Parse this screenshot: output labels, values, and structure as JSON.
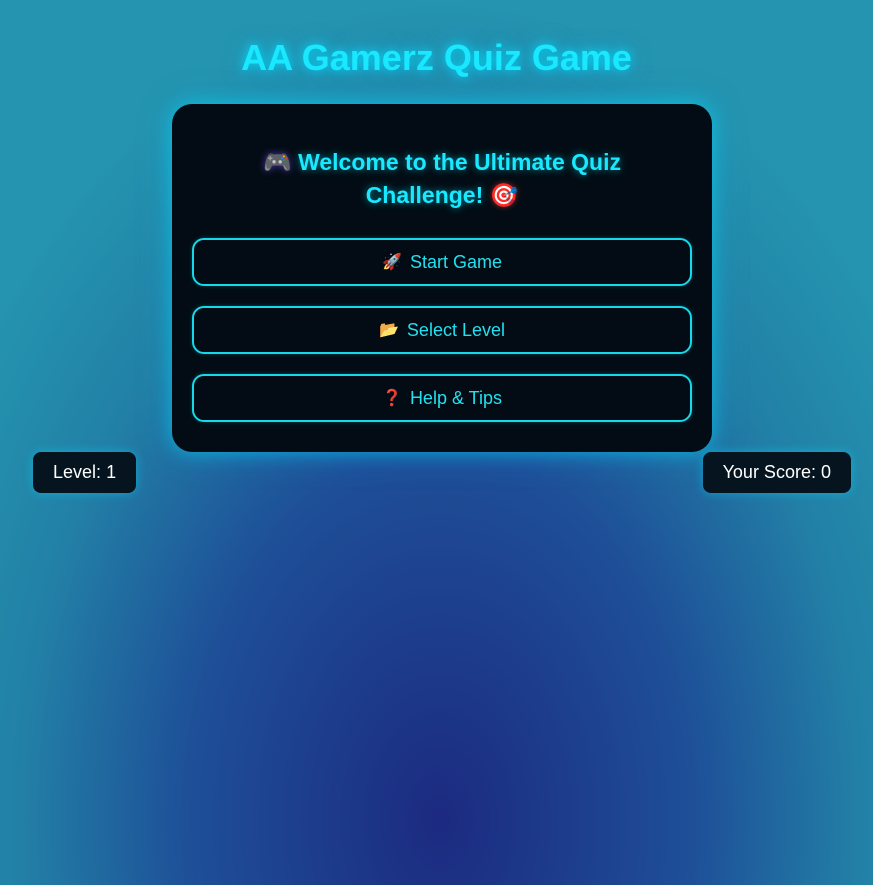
{
  "header": {
    "title": "AA Gamerz Quiz Game"
  },
  "menu": {
    "welcome_icon_left": "🎮",
    "welcome_text": "Welcome to the Ultimate Quiz Challenge!",
    "welcome_icon_right": "🎯",
    "buttons": [
      {
        "icon": "🚀",
        "icon_name": "rocket-icon",
        "label": "Start Game"
      },
      {
        "icon": "📂",
        "icon_name": "folder-icon",
        "label": "Select Level"
      },
      {
        "icon": "❓",
        "icon_name": "question-icon",
        "label": "Help & Tips"
      }
    ]
  },
  "stats": {
    "level_label": "Level:",
    "level_value": "1",
    "score_label": "Your Score:",
    "score_value": "0"
  },
  "colors": {
    "accent": "#19e8ff",
    "card_background": "#030c14",
    "button_border": "#16d8e8"
  }
}
